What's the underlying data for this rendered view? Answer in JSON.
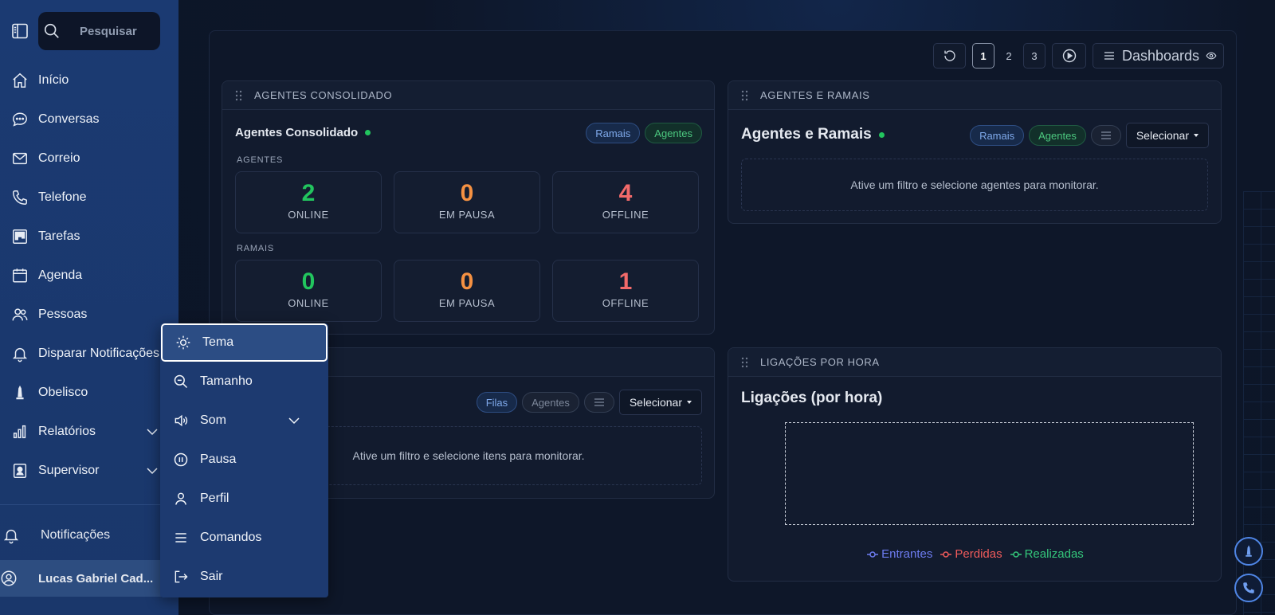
{
  "sidebar": {
    "search_placeholder": "Pesquisar",
    "items": [
      {
        "label": "Início"
      },
      {
        "label": "Conversas"
      },
      {
        "label": "Correio"
      },
      {
        "label": "Telefone"
      },
      {
        "label": "Tarefas"
      },
      {
        "label": "Agenda"
      },
      {
        "label": "Pessoas"
      },
      {
        "label": "Disparar Notificações"
      },
      {
        "label": "Obelisco"
      },
      {
        "label": "Relatórios"
      },
      {
        "label": "Supervisor"
      }
    ],
    "notifications_label": "Notificações",
    "user_name": "Lucas Gabriel Cad..."
  },
  "toolbar": {
    "pages": [
      "1",
      "2",
      "3"
    ],
    "active_page": "1",
    "dashboards_label": "Dashboards"
  },
  "panel_agentes_consolidado": {
    "header": "AGENTES CONSOLIDADO",
    "title": "Agentes Consolidado",
    "pill_ramais": "Ramais",
    "pill_agentes": "Agentes",
    "section_agentes": "AGENTES",
    "section_ramais": "RAMAIS",
    "agentes_stats": [
      {
        "value": "2",
        "label": "ONLINE"
      },
      {
        "value": "0",
        "label": "EM PAUSA"
      },
      {
        "value": "4",
        "label": "OFFLINE"
      }
    ],
    "ramais_stats": [
      {
        "value": "0",
        "label": "ONLINE"
      },
      {
        "value": "0",
        "label": "EM PAUSA"
      },
      {
        "value": "1",
        "label": "OFFLINE"
      }
    ]
  },
  "panel_agentes_ramais": {
    "header": "AGENTES E RAMAIS",
    "title": "Agentes e Ramais",
    "pill_ramais": "Ramais",
    "pill_agentes": "Agentes",
    "select_label": "Selecionar",
    "empty_text": "Ative um filtro e selecione agentes para monitorar."
  },
  "panel_filas": {
    "pill_filas": "Filas",
    "pill_agentes": "Agentes",
    "select_label": "Selecionar",
    "empty_text": "Ative um filtro e selecione itens para monitorar."
  },
  "panel_ligacoes": {
    "header": "LIGAÇÕES POR HORA",
    "title": "Ligações (por hora)",
    "legend": [
      {
        "name": "Entrantes",
        "color": "#6d7cf0"
      },
      {
        "name": "Perdidas",
        "color": "#ef5b5b"
      },
      {
        "name": "Realizadas",
        "color": "#34c77b"
      }
    ]
  },
  "popup_menu": {
    "items": [
      {
        "label": "Tema",
        "icon": "sun-icon"
      },
      {
        "label": "Tamanho",
        "icon": "zoom-out-icon"
      },
      {
        "label": "Som",
        "icon": "volume-icon"
      },
      {
        "label": "Pausa",
        "icon": "pause-circle-icon"
      },
      {
        "label": "Perfil",
        "icon": "user-icon"
      },
      {
        "label": "Comandos",
        "icon": "menu-lines-icon"
      },
      {
        "label": "Sair",
        "icon": "logout-icon"
      }
    ]
  },
  "colors": {
    "sidebar_bg": "#1b3a72",
    "accent_green": "#22c55e",
    "accent_orange": "#f59142",
    "accent_red": "#f36a6a"
  }
}
